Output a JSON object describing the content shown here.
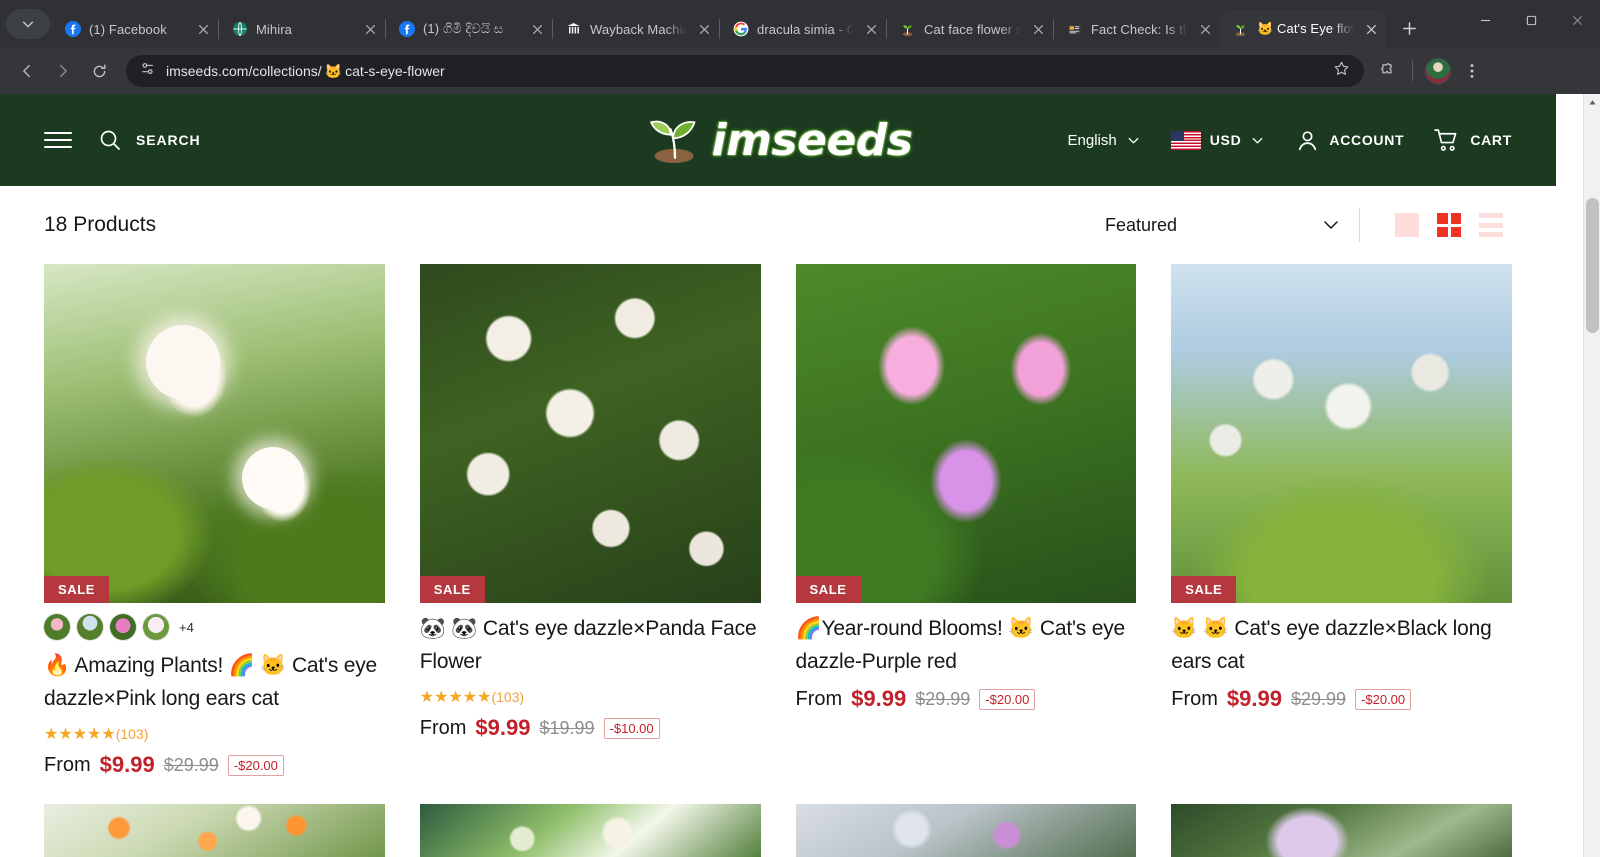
{
  "browser": {
    "tabs": [
      {
        "title": "(1) Facebook",
        "favicon": "facebook-icon",
        "glyph": "f",
        "active": false
      },
      {
        "title": "Mihira",
        "favicon": "globe-icon",
        "glyph": "🌐",
        "active": false
      },
      {
        "title": "(1) ගිමී දිවයි ස",
        "favicon": "facebook-icon",
        "glyph": "f",
        "active": false
      },
      {
        "title": "Wayback Machin",
        "favicon": "archive-icon",
        "glyph": "🏛",
        "active": false
      },
      {
        "title": "dracula simia - G",
        "favicon": "google-icon",
        "glyph": "G",
        "active": false
      },
      {
        "title": "Cat face flower s",
        "favicon": "seedling-icon",
        "glyph": "🌱",
        "active": false
      },
      {
        "title": "Fact Check: Is th",
        "favicon": "news-icon",
        "glyph": "📰",
        "active": false
      },
      {
        "title": "🐱 Cat's Eye flow",
        "favicon": "seedling-icon",
        "glyph": "🌱",
        "active": true
      }
    ],
    "new_tab_label": "+",
    "window_controls": {
      "minimize": "–",
      "maximize": "❐",
      "close": "✕"
    },
    "nav": {
      "back": "back-arrow-icon",
      "forward": "forward-arrow-icon",
      "reload": "reload-icon"
    },
    "omnibox": {
      "site_info_icon": "page-info-icon",
      "url_prefix": "imseeds.com/collections/",
      "url_emoji": "🐱",
      "url_suffix": "cat-s-eye-flower",
      "bookmark_icon": "star-icon"
    },
    "toolbar_right": {
      "extensions": "extensions-puzzle-icon",
      "profile": "profile-avatar",
      "menu": "three-dot-menu-icon"
    }
  },
  "site_header": {
    "menu_icon": "hamburger-menu-icon",
    "search_icon": "search-icon",
    "search_label": "SEARCH",
    "logo_text": "imseeds",
    "logo_icon": "seedling-logo-icon",
    "language": "English",
    "currency": "USD",
    "currency_flag": "us-flag-icon",
    "account_label": "ACCOUNT",
    "account_icon": "person-icon",
    "cart_label": "CART",
    "cart_icon": "shopping-cart-icon",
    "chevron_icon": "chevron-down-icon",
    "bg_color": "#1b3a20"
  },
  "collection": {
    "product_count": "18 Products",
    "sort_label": "Featured",
    "sort_chevron": "chevron-down-icon",
    "views": [
      {
        "name": "view-single-column",
        "active": false
      },
      {
        "name": "view-grid",
        "active": true
      },
      {
        "name": "view-list",
        "active": false
      }
    ],
    "accent_color": "#ef3124",
    "sale_badge_color": "#b5383f",
    "price_color": "#c2202a"
  },
  "products": [
    {
      "sale_label": "SALE",
      "title": "🔥 Amazing Plants! 🌈 🐱 Cat's eye dazzle×Pink long ears cat",
      "has_swatches": true,
      "swatch_count": 4,
      "more_swatches": "+4",
      "stars": "★★★★★",
      "review_count": "(103)",
      "from_label": "From",
      "price": "$9.99",
      "compare_at": "$29.99",
      "discount": "-$20.00",
      "image": "pink-long-ears-cat-flowers"
    },
    {
      "sale_label": "SALE",
      "title": "🐼 🐼 Cat's eye dazzle×Panda Face Flower",
      "has_swatches": false,
      "stars": "★★★★★",
      "review_count": "(103)",
      "from_label": "From",
      "price": "$9.99",
      "compare_at": "$19.99",
      "discount": "-$10.00",
      "image": "panda-face-flowers"
    },
    {
      "sale_label": "SALE",
      "title": "🌈Year-round Blooms! 🐱 Cat's eye dazzle-Purple red",
      "has_swatches": false,
      "stars": "",
      "review_count": "",
      "from_label": "From",
      "price": "$9.99",
      "compare_at": "$29.99",
      "discount": "-$20.00",
      "image": "purple-red-cat-flowers"
    },
    {
      "sale_label": "SALE",
      "title": "🐱 🐱 Cat's eye dazzle×Black long ears cat",
      "has_swatches": false,
      "stars": "",
      "review_count": "",
      "from_label": "From",
      "price": "$9.99",
      "compare_at": "$29.99",
      "discount": "-$20.00",
      "image": "black-long-ears-cat-flowers"
    }
  ],
  "products_row2": [
    {
      "image": "orange-white-flowers"
    },
    {
      "image": "green-white-flower"
    },
    {
      "image": "purple-grey-flower"
    },
    {
      "image": "lilac-spiky-flower"
    }
  ]
}
